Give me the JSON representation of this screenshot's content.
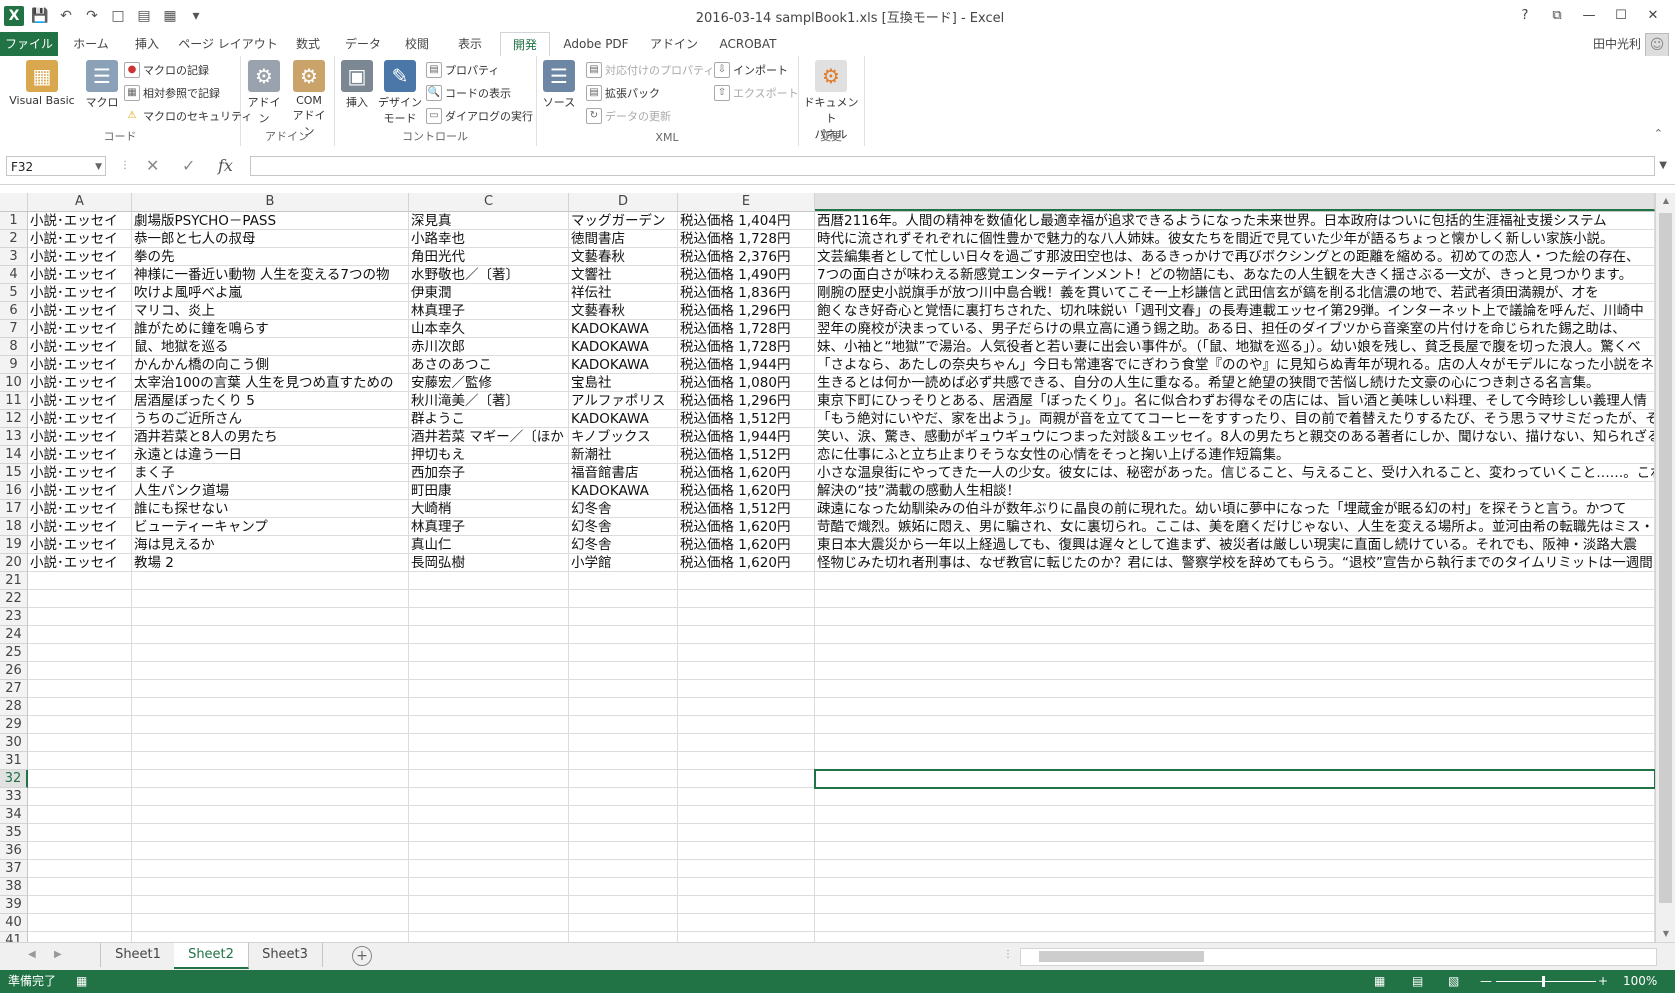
{
  "window": {
    "title": "2016-03-14 samplBook1.xls [互換モード] - Excel",
    "help": "?",
    "controls": [
      "⧉",
      "—",
      "☐",
      "✕"
    ]
  },
  "qat": {
    "logo": "X",
    "icons": [
      "save-icon",
      "undo-icon",
      "redo-icon"
    ]
  },
  "tabs": [
    "ファイル",
    "ホーム",
    "挿入",
    "ページ レイアウト",
    "数式",
    "データ",
    "校閲",
    "表示",
    "開発",
    "Adobe PDF",
    "アドイン",
    "ACROBAT"
  ],
  "active_tab": "開発",
  "user": "田中光利",
  "ribbon": {
    "code": {
      "label": "コード",
      "visual_basic": "Visual Basic",
      "macro": "マクロ",
      "record": "マクロの記録",
      "relative": "相対参照で記録",
      "security": "マクロのセキュリティ"
    },
    "addin": {
      "label": "アドイン",
      "addin": "アドイン",
      "com_addin1": "COM",
      "com_addin2": "アドイン"
    },
    "control": {
      "label": "コントロール",
      "insert": "挿入",
      "design1": "デザイン",
      "design2": "モード",
      "properties": "プロパティ",
      "view_code": "コードの表示",
      "dialog": "ダイアログの実行"
    },
    "xml": {
      "label": "XML",
      "source": "ソース",
      "map_props": "対応付けのプロパティ",
      "expansion": "拡張パック",
      "refresh": "データの更新",
      "import": "インポート",
      "export": "エクスポート"
    },
    "modify": {
      "label": "変更",
      "doc_panel1": "ドキュメント",
      "doc_panel2": "パネル"
    }
  },
  "formula_bar": {
    "name_box": "F32",
    "cancel": "✕",
    "enter": "✓",
    "fx": "fx",
    "formula": ""
  },
  "columns": [
    "A",
    "B",
    "C",
    "D",
    "E",
    ""
  ],
  "selected_cell": {
    "column": "F",
    "row": 32
  },
  "rows": [
    [
      "小説･エッセイ",
      "劇場版PSYCHO－PASS",
      "深見真",
      "マッグガーデン",
      "税込価格 1,404円",
      "西暦2116年。人間の精神を数値化し最適幸福が追求できるようになった未来世界。日本政府はついに包括的生涯福祉支援システム"
    ],
    [
      "小説･エッセイ",
      "恭一郎と七人の叔母",
      "小路幸也",
      "徳間書店",
      "税込価格 1,728円",
      "時代に流されずそれぞれに個性豊かで魅力的な八人姉妹。彼女たちを間近で見ていた少年が語るちょっと懐かしく新しい家族小説。"
    ],
    [
      "小説･エッセイ",
      "拳の先",
      "角田光代",
      "文藝春秋",
      "税込価格 2,376円",
      "文芸編集者として忙しい日々を過ごす那波田空也は、あるきっかけで再びボクシングとの距離を縮める。初めての恋人・つた絵の存在、"
    ],
    [
      "小説･エッセイ",
      "神様に一番近い動物 人生を変える7つの物",
      "水野敬也／〔著〕",
      "文響社",
      "税込価格 1,490円",
      "7つの面白さが味わえる新感覚エンターテインメント！どの物語にも、あなたの人生観を大きく揺さぶる一文が、きっと見つかります。"
    ],
    [
      "小説･エッセイ",
      "吹けよ風呼べよ嵐",
      "伊東潤",
      "祥伝社",
      "税込価格 1,836円",
      "剛腕の歴史小説旗手が放つ川中島合戦！義を貫いてこそ一上杉謙信と武田信玄が鎬を削る北信濃の地で、若武者須田満親が、才を"
    ],
    [
      "小説･エッセイ",
      "マリコ、炎上",
      "林真理子",
      "文藝春秋",
      "税込価格 1,296円",
      "飽くなき好奇心と覚悟に裏打ちされた、切れ味鋭い「週刊文春」の長寿連載エッセイ第29弾。インターネット上で議論を呼んだ、川崎中"
    ],
    [
      "小説･エッセイ",
      "誰がために鐘を鳴らす",
      "山本幸久",
      "KADOKAWA",
      "税込価格 1,728円",
      "翌年の廃校が決まっている、男子だらけの県立高に通う錫之助。ある日、担任のダイブツから音楽室の片付けを命じられた錫之助は、"
    ],
    [
      "小説･エッセイ",
      "鼠、地獄を巡る",
      "赤川次郎",
      "KADOKAWA",
      "税込価格 1,728円",
      "妹、小袖と“地獄”で湯治。人気役者と若い妻に出会い事件が。（「鼠、地獄を巡る」）。幼い娘を残し、貧乏長屋で腹を切った浪人。驚くべ"
    ],
    [
      "小説･エッセイ",
      "かんかん橋の向こう側",
      "あさのあつこ",
      "KADOKAWA",
      "税込価格 1,944円",
      "「さよなら、あたしの奈央ちゃん」今日も常連客でにぎわう食堂『ののや』に見知らぬ青年が現れる。店の人々がモデルになった小説をネッ"
    ],
    [
      "小説･エッセイ",
      "太宰治100の言葉 人生を見つめ直すための",
      "安藤宏／監修",
      "宝島社",
      "税込価格 1,080円",
      "生きるとは何か一読めば必ず共感できる、自分の人生に重なる。希望と絶望の狭間で苦悩し続けた文豪の心につき刺さる名言集。"
    ],
    [
      "小説･エッセイ",
      "居酒屋ぼったくり 5",
      "秋川滝美／〔著〕",
      "アルファポリス",
      "税込価格 1,296円",
      "東京下町にひっそりとある、居酒屋「ぼったくり」。名に似合わずお得なその店には、旨い酒と美味しい料理、そして今時珍しい義理人情"
    ],
    [
      "小説･エッセイ",
      "うちのご近所さん",
      "群ようこ",
      "KADOKAWA",
      "税込価格 1,512円",
      "「もう絶対にいやだ、家を出よう」。両親が音を立ててコーヒーをすすったり、目の前で着替えたりするたび、そう思うマサミだったが、そう"
    ],
    [
      "小説･エッセイ",
      "酒井若菜と8人の男たち",
      "酒井若菜 マギー／〔ほか",
      "キノブックス",
      "税込価格 1,944円",
      "笑い、涙、驚き、感動がギュウギュウにつまった対談＆エッセイ。8人の男たちと親交のある著者にしか、聞けない、描けない、知られざる"
    ],
    [
      "小説･エッセイ",
      "永遠とは違う一日",
      "押切もえ",
      "新潮社",
      "税込価格 1,512円",
      "恋に仕事にふと立ち止まりそうな女性の心情をそっと掬い上げる連作短篇集。"
    ],
    [
      "小説･エッセイ",
      "まく子",
      "西加奈子",
      "福音館書店",
      "税込価格 1,620円",
      "小さな温泉街にやってきた一人の少女。彼女には、秘密があった。信じること、与えること、受け入れること、変わっていくこと……。これ"
    ],
    [
      "小説･エッセイ",
      "人生パンク道場",
      "町田康",
      "KADOKAWA",
      "税込価格 1,620円",
      "解決の“技”満載の感動人生相談！"
    ],
    [
      "小説･エッセイ",
      "誰にも探せない",
      "大崎梢",
      "幻冬舎",
      "税込価格 1,512円",
      "疎遠になった幼馴染みの伯斗が数年ぶりに晶良の前に現れた。幼い頃に夢中になった「埋蔵金が眠る幻の村」を探そうと言う。かつて"
    ],
    [
      "小説･エッセイ",
      "ビューティーキャンプ",
      "林真理子",
      "幻冬舎",
      "税込価格 1,620円",
      "苛酷で熾烈。嫉妬に悶え、男に騙され、女に裏切られ。ここは、美を磨くだけじゃない、人生を変える場所よ。並河由希の転職先はミス・"
    ],
    [
      "小説･エッセイ",
      "海は見えるか",
      "真山仁",
      "幻冬舎",
      "税込価格 1,620円",
      "東日本大震災から一年以上経過しても、復興は遅々として進まず、被災者は厳しい現実に直面し続けている。それでも、阪神・淡路大震"
    ],
    [
      "小説･エッセイ",
      "教場 2",
      "長岡弘樹",
      "小学館",
      "税込価格 1,620円",
      "怪物じみた切れ者刑事は、なぜ教官に転じたのか？君には、警察学校を辞めてもらう。“退校”宣告から執行までのタイムリミットは一週間"
    ]
  ],
  "empty_row_numbers": [
    21,
    22,
    23,
    24,
    25,
    26,
    27,
    28,
    29,
    30,
    31,
    32,
    33,
    34,
    35,
    36,
    37,
    38,
    39,
    40,
    41
  ],
  "sheets": [
    "Sheet1",
    "Sheet2",
    "Sheet3"
  ],
  "active_sheet": "Sheet2",
  "status": {
    "ready": "準備完了",
    "zoom": "100%",
    "minus": "—",
    "plus": "+"
  }
}
